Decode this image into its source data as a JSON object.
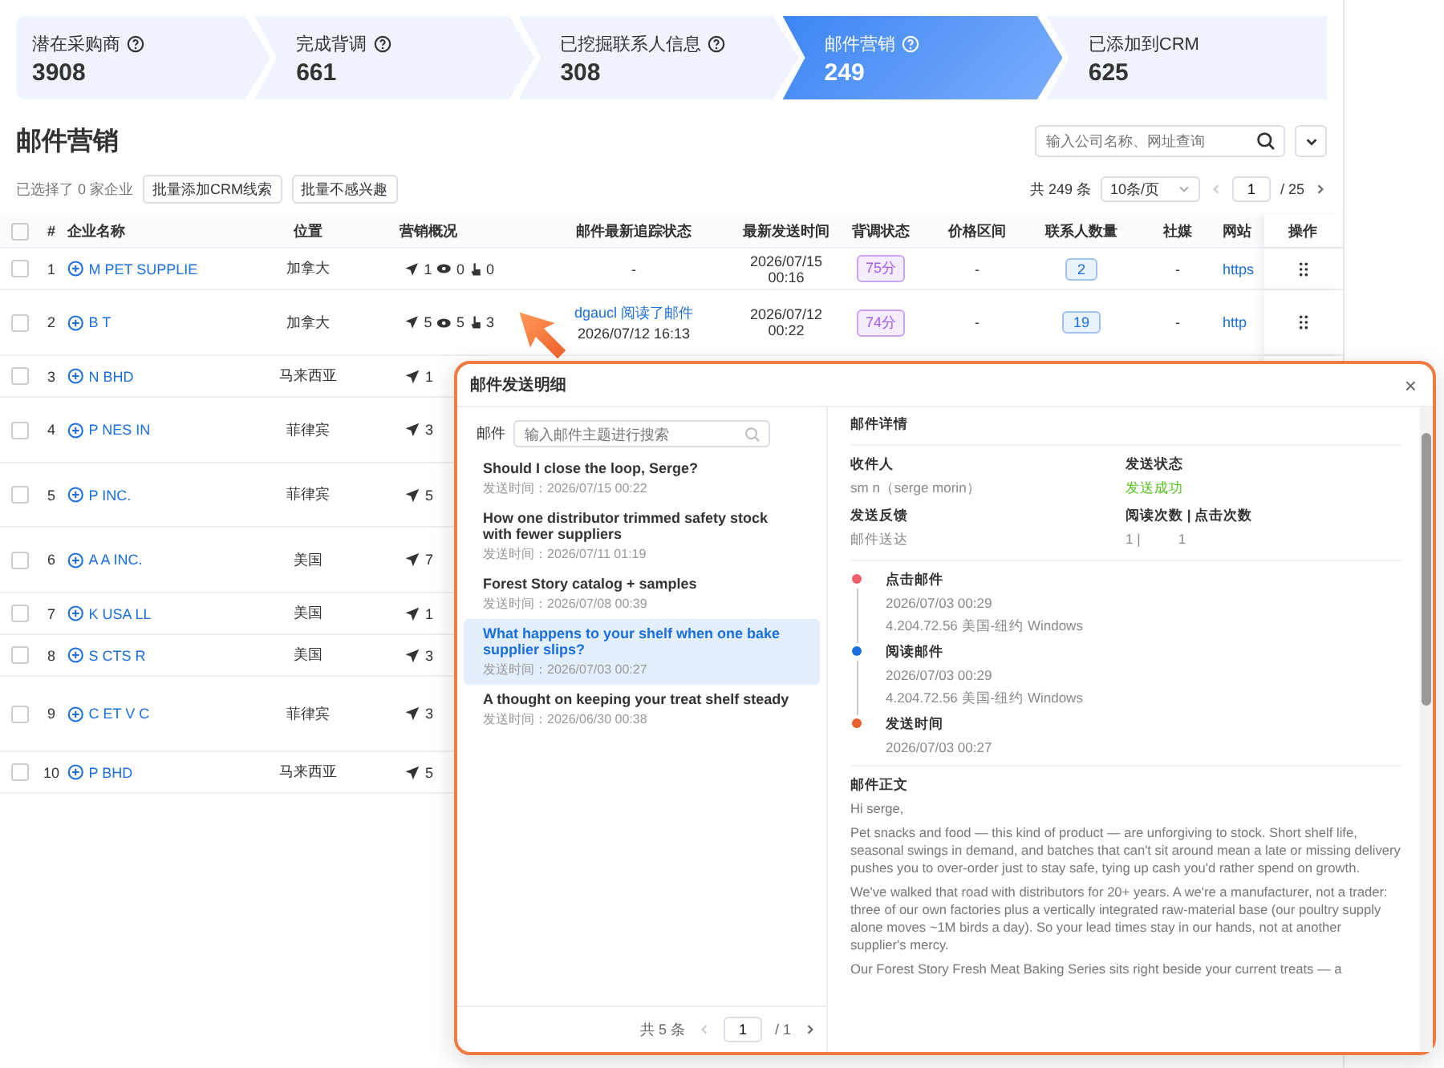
{
  "stages": [
    {
      "label": "潜在采购商",
      "count": "3908",
      "help": true,
      "selected": false
    },
    {
      "label": "完成背调",
      "count": "661",
      "help": true,
      "selected": false
    },
    {
      "label": "已挖掘联系人信息",
      "count": "308",
      "help": true,
      "selected": false
    },
    {
      "label": "邮件营销",
      "count": "249",
      "help": true,
      "selected": true
    },
    {
      "label": "已添加到CRM",
      "count": "625",
      "help": false,
      "selected": false
    }
  ],
  "page_title": "邮件营销",
  "search": {
    "placeholder": "输入公司名称、网址查询"
  },
  "selection_text": "已选择了 0 家企业",
  "bulk_buttons": [
    "批量添加CRM线索",
    "批量不感兴趣"
  ],
  "pagination": {
    "total": "共 249 条",
    "page_size": "10条/页",
    "page": "1",
    "pages": "/ 25"
  },
  "table": {
    "select_all": false,
    "columns": [
      "#",
      "企业名称",
      "位置",
      "营销概况",
      "邮件最新追踪状态",
      "最新发送时间",
      "背调状态",
      "价格区间",
      "联系人数量",
      "社媒",
      "网站",
      "操作"
    ],
    "rows": [
      {
        "checked": false,
        "index": "1",
        "name": "M PET SUPPLIE",
        "location": "加拿大",
        "sent": "1",
        "opened": "0",
        "clicked": "0",
        "status": "-",
        "time": "2026/07/15 00:16",
        "score": "75分",
        "price": "-",
        "contacts": "2",
        "social": "-",
        "site": "https"
      },
      {
        "checked": false,
        "index": "2",
        "name": "B T",
        "location": "加拿大",
        "sent": "5",
        "opened": "5",
        "clicked": "3",
        "status_link": "dgaucl 阅读了邮件",
        "status_time": "2026/07/12 16:13",
        "time": "2026/07/12 00:22",
        "score": "74分",
        "price": "-",
        "contacts": "19",
        "social": "-",
        "site": "http"
      },
      {
        "checked": false,
        "index": "3",
        "name": "N BHD",
        "location": "马来西亚",
        "sent": "1"
      },
      {
        "checked": false,
        "index": "4",
        "name": "P NES IN",
        "location": "菲律宾",
        "sent": "3"
      },
      {
        "checked": false,
        "index": "5",
        "name": "P INC.",
        "location": "菲律宾",
        "sent": "5"
      },
      {
        "checked": false,
        "index": "6",
        "name": "A A INC.",
        "location": "美国",
        "sent": "7"
      },
      {
        "checked": false,
        "index": "7",
        "name": "K USA LL",
        "location": "美国",
        "sent": "1"
      },
      {
        "checked": false,
        "index": "8",
        "name": "S CTS R",
        "location": "美国",
        "sent": "3"
      },
      {
        "checked": false,
        "index": "9",
        "name": "C ET V C",
        "location": "菲律宾",
        "sent": "3"
      },
      {
        "checked": false,
        "index": "10",
        "name": "P BHD",
        "location": "马来西亚",
        "sent": "5"
      }
    ]
  },
  "dialog": {
    "title": "邮件发送明细",
    "close": "×",
    "mail_label": "邮件",
    "mail_search": {
      "placeholder": "输入邮件主题进行搜索"
    },
    "mails": [
      {
        "subject": "Should I close the loop, Serge?",
        "time": "发送时间：2026/07/15 00:22",
        "selected": false
      },
      {
        "subject": "How one distributor trimmed safety stock with fewer suppliers",
        "time": "发送时间：2026/07/11 01:19",
        "selected": false
      },
      {
        "subject": "Forest Story catalog + samples",
        "time": "发送时间：2026/07/08 00:39",
        "selected": false
      },
      {
        "subject": "What happens to your shelf when one bake supplier slips?",
        "time": "发送时间：2026/07/03 00:27",
        "selected": true
      },
      {
        "subject": "A thought on keeping your treat shelf steady",
        "time": "发送时间：2026/06/30 00:38",
        "selected": false
      }
    ],
    "mail_pagination": {
      "total": "共 5 条",
      "page": "1",
      "pages": "/ 1"
    },
    "detail_title": "邮件详情",
    "fields": [
      {
        "label": "收件人",
        "value": "sm n（serge morin）",
        "kind": "plain"
      },
      {
        "label": "发送状态",
        "value": "发送成功",
        "kind": "success"
      },
      {
        "label": "发送反馈",
        "value": "邮件送达",
        "kind": "plain"
      },
      {
        "label": "阅读次数 | 点击次数",
        "value": "1 |          1",
        "kind": "plain"
      }
    ],
    "timeline": [
      {
        "title": "点击邮件",
        "lines": [
          "2026/07/03 00:29",
          "4.204.72.56 美国-纽约 Windows"
        ],
        "color": "#f0606a"
      },
      {
        "title": "阅读邮件",
        "lines": [
          "2026/07/03 00:29",
          "4.204.72.56 美国-纽约 Windows"
        ],
        "color": "#1a6fe0"
      },
      {
        "title": "发送时间",
        "lines": [
          "2026/07/03 00:27"
        ],
        "color": "#e8602c"
      }
    ],
    "body_title": "邮件正文",
    "body": [
      "Hi serge,",
      "Pet snacks and food — this kind of product — are unforgiving to stock. Short shelf life, seasonal swings in demand, and batches that can't sit around mean a late or missing delivery pushes you to over-order just to stay safe, tying up cash you'd rather spend on growth.",
      "We've walked that road with distributors for 20+ years. A we're a manufacturer, not a trader: three of our own factories plus a vertically integrated raw-material base (our poultry supply alone moves ~1M birds a day). So your lead times stay in our hands, not at another supplier's mercy.",
      "Our Forest Story Fresh Meat Baking Series sits right beside your current treats — a"
    ]
  }
}
